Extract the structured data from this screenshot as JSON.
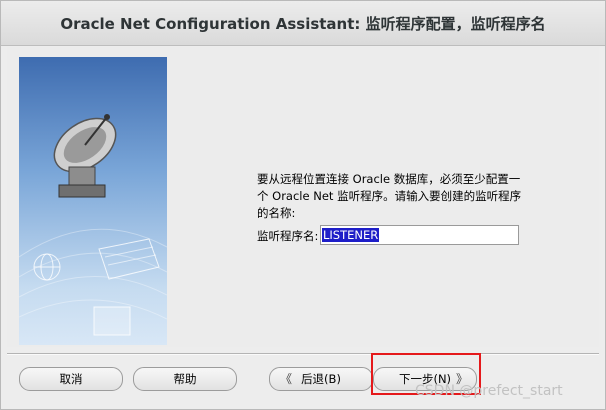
{
  "window": {
    "title": "Oracle Net Configuration Assistant: 监听程序配置，监听程序名"
  },
  "main": {
    "description": "要从远程位置连接 Oracle 数据库，必须至少配置一个 Oracle Net 监听程序。请输入要创建的监听程序的名称:",
    "listener_name_label": "监听程序名:",
    "listener_name_value": "LISTENER"
  },
  "buttons": {
    "cancel": "取消",
    "help": "帮助",
    "back": "后退(B)",
    "next": "下一步(N)",
    "back_arrow": "《",
    "next_arrow": "》"
  },
  "watermark": "CSDN @prefect_start",
  "colors": {
    "highlight_border": "#e5191b",
    "selection_bg": "#1e1ec8"
  },
  "icons": {
    "satellite": "satellite-dish-icon",
    "globe": "globe-icon",
    "keyboard": "keyboard-icon",
    "document": "document-icon"
  }
}
